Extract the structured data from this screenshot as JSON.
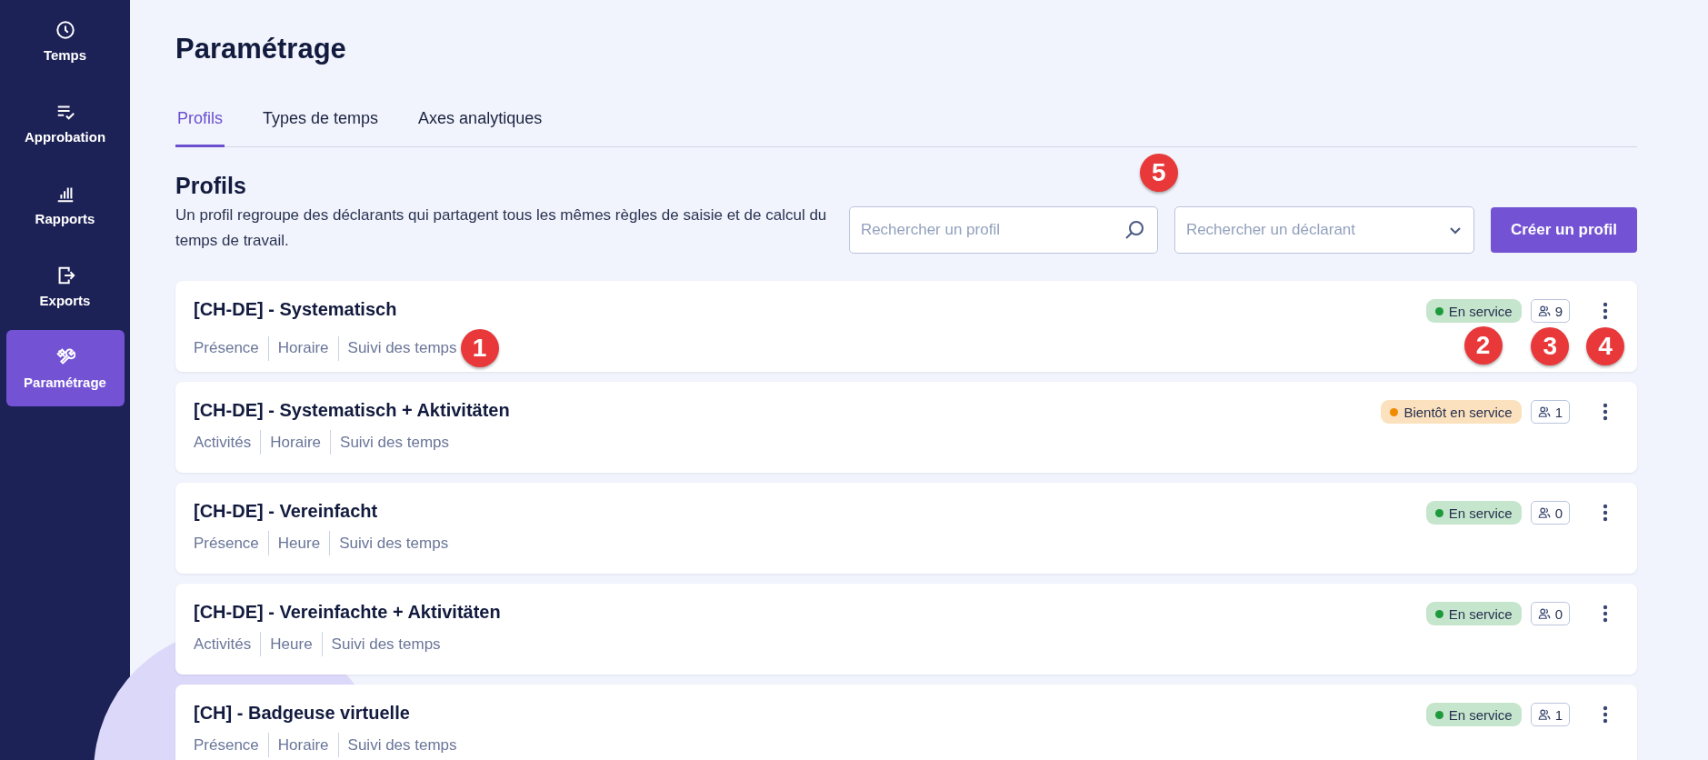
{
  "sidebar": {
    "items": [
      {
        "label": "Temps",
        "selected": false
      },
      {
        "label": "Approbation",
        "selected": false
      },
      {
        "label": "Rapports",
        "selected": false
      },
      {
        "label": "Exports",
        "selected": false
      },
      {
        "label": "Paramétrage",
        "selected": true
      }
    ]
  },
  "page": {
    "title": "Paramétrage"
  },
  "tabs": [
    {
      "label": "Profils",
      "selected": true
    },
    {
      "label": "Types de temps",
      "selected": false
    },
    {
      "label": "Axes analytiques",
      "selected": false
    }
  ],
  "section": {
    "title": "Profils",
    "description": "Un profil regroupe des déclarants qui partagent tous les mêmes règles de saisie et de calcul du temps de travail.",
    "callout": "5"
  },
  "search_profile": {
    "placeholder": "Rechercher un profil"
  },
  "search_declarant": {
    "placeholder": "Rechercher un déclarant"
  },
  "create_button": "Créer un profil",
  "profiles": [
    {
      "name": "[CH-DE] - Systematisch",
      "tags": [
        "Présence",
        "Horaire",
        "Suivi des temps"
      ],
      "status": "En service",
      "color": "#1e9a3c",
      "count": "9",
      "callouts": {
        "tags": "1",
        "status": "2",
        "count": "3",
        "menu": "4"
      }
    },
    {
      "name": "[CH-DE] - Systematisch + Aktivitäten",
      "tags": [
        "Activités",
        "Horaire",
        "Suivi des temps"
      ],
      "status": "Bientôt en service",
      "color": "#f08a00",
      "count": "1"
    },
    {
      "name": "[CH-DE] - Vereinfacht",
      "tags": [
        "Présence",
        "Heure",
        "Suivi des temps"
      ],
      "status": "En service",
      "color": "#1e9a3c",
      "count": "0"
    },
    {
      "name": "[CH-DE] - Vereinfachte + Aktivitäten",
      "tags": [
        "Activités",
        "Heure",
        "Suivi des temps"
      ],
      "status": "En service",
      "color": "#1e9a3c",
      "count": "0"
    },
    {
      "name": "[CH] - Badgeuse virtuelle",
      "tags": [
        "Présence",
        "Horaire",
        "Suivi des temps"
      ],
      "status": "En service",
      "color": "#1e9a3c",
      "count": "1"
    }
  ]
}
